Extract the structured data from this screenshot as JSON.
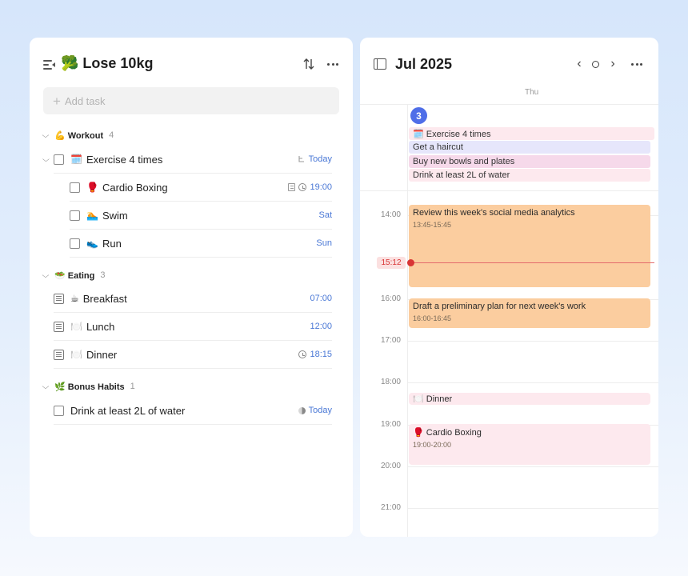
{
  "list": {
    "title": "🥦 Lose 10kg",
    "add_task_placeholder": "Add task",
    "sections": [
      {
        "label": "💪 Workout",
        "count": "4"
      },
      {
        "label": "🥗 Eating",
        "count": "3"
      },
      {
        "label": "🌿 Bonus Habits",
        "count": "1"
      }
    ],
    "tasks": [
      {
        "label": "Exercise 4 times",
        "emoji": "🗓️",
        "meta": "Today"
      },
      {
        "label": "Cardio Boxing",
        "emoji": "🥊",
        "meta": "19:00"
      },
      {
        "label": "Swim",
        "emoji": "🏊",
        "meta": "Sat"
      },
      {
        "label": "Run",
        "emoji": "👟",
        "meta": "Sun"
      },
      {
        "label": "Breakfast",
        "emoji": "☕",
        "meta": "07:00"
      },
      {
        "label": "Lunch",
        "emoji": "🍽️",
        "meta": "12:00"
      },
      {
        "label": "Dinner",
        "emoji": "🍽️",
        "meta": "18:15"
      },
      {
        "label": "Drink at least 2L of water",
        "meta": "Today"
      }
    ]
  },
  "calendar": {
    "title": "Jul 2025",
    "weekday": "Thu",
    "date_number": "3",
    "now_time": "15:12",
    "all_day_events": [
      {
        "label": "🗓️ Exercise 4 times",
        "color": "#fde9ee"
      },
      {
        "label": "Get a haircut",
        "color": "#e6e6fb"
      },
      {
        "label": "Buy new bowls and plates",
        "color": "#f6d9ea"
      },
      {
        "label": "Drink at least 2L of water",
        "color": "#fde9ee"
      }
    ],
    "time_labels": [
      "14:00",
      "16:00",
      "17:00",
      "18:00",
      "19:00",
      "20:00",
      "21:00"
    ],
    "events": [
      {
        "title": "Review this week's social media analytics",
        "time": "13:45-15:45",
        "color": "#fbcd9f"
      },
      {
        "title": "Draft a preliminary plan for next week's work",
        "time": "16:00-16:45",
        "color": "#fbcd9f"
      },
      {
        "title": "🍽️ Dinner",
        "color": "#fde9ee"
      },
      {
        "title": "🥊 Cardio Boxing",
        "time": "19:00-20:00",
        "color": "#fde9ee"
      }
    ]
  },
  "colors": {
    "accent": "#4f6ee8",
    "link": "#4a78d6",
    "now": "#d93535"
  }
}
